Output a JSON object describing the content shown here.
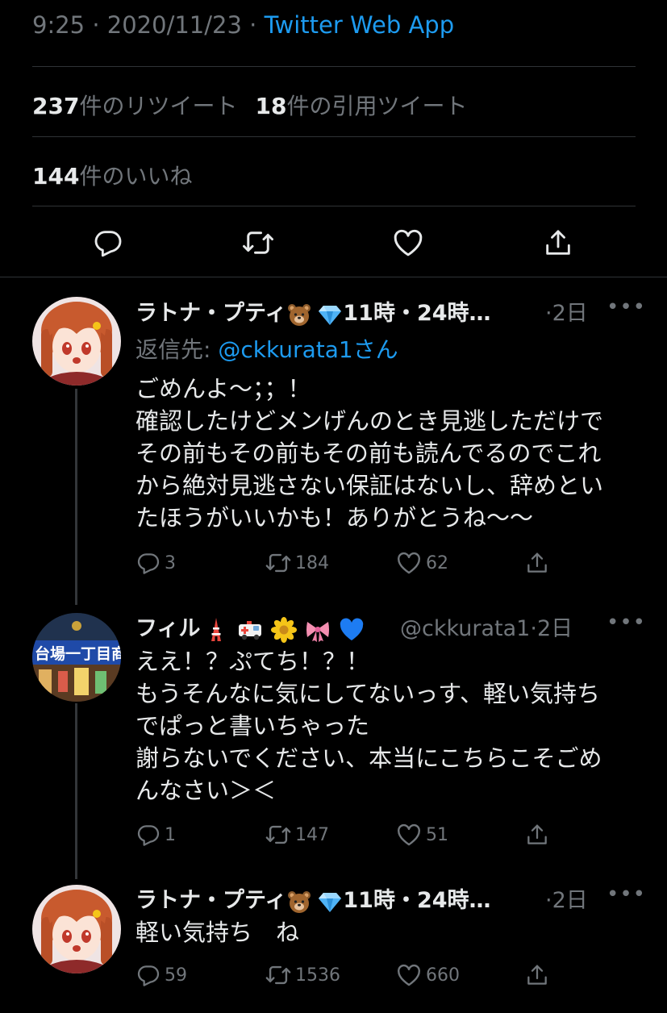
{
  "tweet_meta": {
    "time": "9:25",
    "date": "2020/11/23",
    "source": "Twitter Web App"
  },
  "stats": {
    "retweets_count": "237",
    "retweets_label": "件のリツイート",
    "quotes_count": "18",
    "quotes_label": "件の引用ツイート",
    "likes_count": "144",
    "likes_label": "件のいいね"
  },
  "replies": [
    {
      "name": "ラトナ・プティ",
      "name_suffix": "11時・24時…",
      "age": "2日",
      "reply_to_prefix": "返信先: ",
      "reply_to_handle": "@ckkurata1さん",
      "lines": [
        "ごめんよ〜；；！",
        "確認したけどメンげんのとき見逃しただけで",
        "その前もその前もその前も読んでるのでこれ",
        "から絶対見逃さない保証はないし、辞めとい",
        "たほうがいいかも！ありがとうね〜〜"
      ],
      "counts": {
        "replies": "3",
        "retweets": "184",
        "likes": "62"
      }
    },
    {
      "name": "フィル",
      "handle": "@ckkurata1",
      "age": "2日",
      "lines": [
        "ええ！？ぷてち！？！",
        "もうそんなに気にしてないっす、軽い気持ち",
        "でぱっと書いちゃった",
        "謝らないでください、本当にこちらこそごめ",
        "んなさい＞＜"
      ],
      "counts": {
        "replies": "1",
        "retweets": "147",
        "likes": "51"
      }
    },
    {
      "name": "ラトナ・プティ",
      "name_suffix": "11時・24時…",
      "age": "2日",
      "lines": [
        "軽い気持ち　ね"
      ],
      "counts": {
        "replies": "59",
        "retweets": "1536",
        "likes": "660"
      }
    }
  ],
  "icons": [
    "reply-icon",
    "retweet-icon",
    "like-icon",
    "share-icon",
    "more-icon"
  ],
  "colors": {
    "background": "#000000",
    "text": "#e7e9ea",
    "muted": "#71767b",
    "accent": "#1d9bf0",
    "divider": "#2f3336"
  }
}
